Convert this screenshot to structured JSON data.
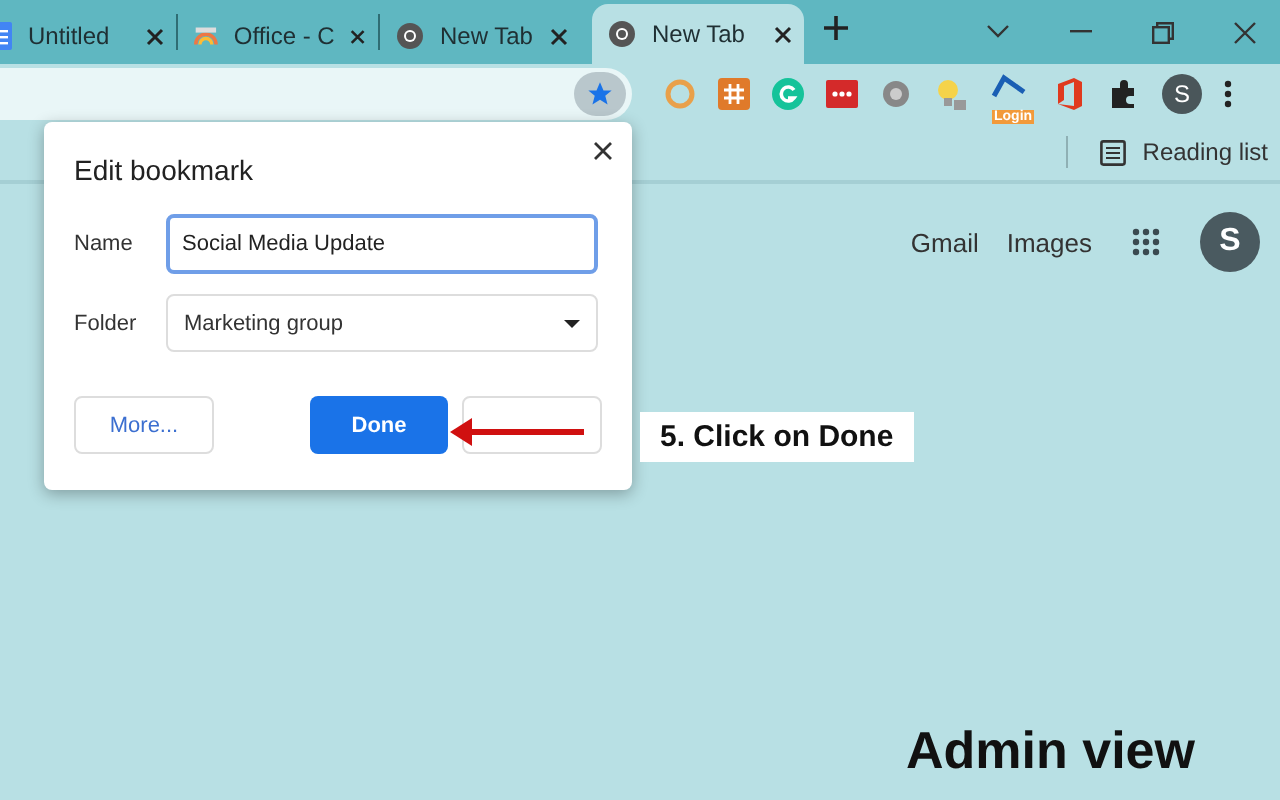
{
  "tabs": [
    {
      "title": "Untitled",
      "kind": "docs",
      "selected": false
    },
    {
      "title": "Office - C",
      "kind": "office",
      "selected": false
    },
    {
      "title": "New Tab",
      "kind": "chrome",
      "selected": false
    },
    {
      "title": "New Tab",
      "kind": "chrome",
      "selected": true
    }
  ],
  "toolbar": {
    "bookmarked": true,
    "extension_badge": "Login",
    "profile_initial": "S"
  },
  "bookmarks_bar": {
    "reading_list": "Reading list"
  },
  "page": {
    "links": [
      "Gmail",
      "Images"
    ],
    "avatar": "S"
  },
  "dialog": {
    "title": "Edit bookmark",
    "name_label": "Name",
    "name_value": "Social Media Update",
    "folder_label": "Folder",
    "folder_value": "Marketing group",
    "buttons": [
      {
        "label": "More...",
        "kind": "secondary"
      },
      {
        "label": "Done",
        "kind": "primary"
      },
      {
        "kind": "secondary"
      }
    ]
  },
  "annotation": "5. Click on Done",
  "caption": "Admin view"
}
